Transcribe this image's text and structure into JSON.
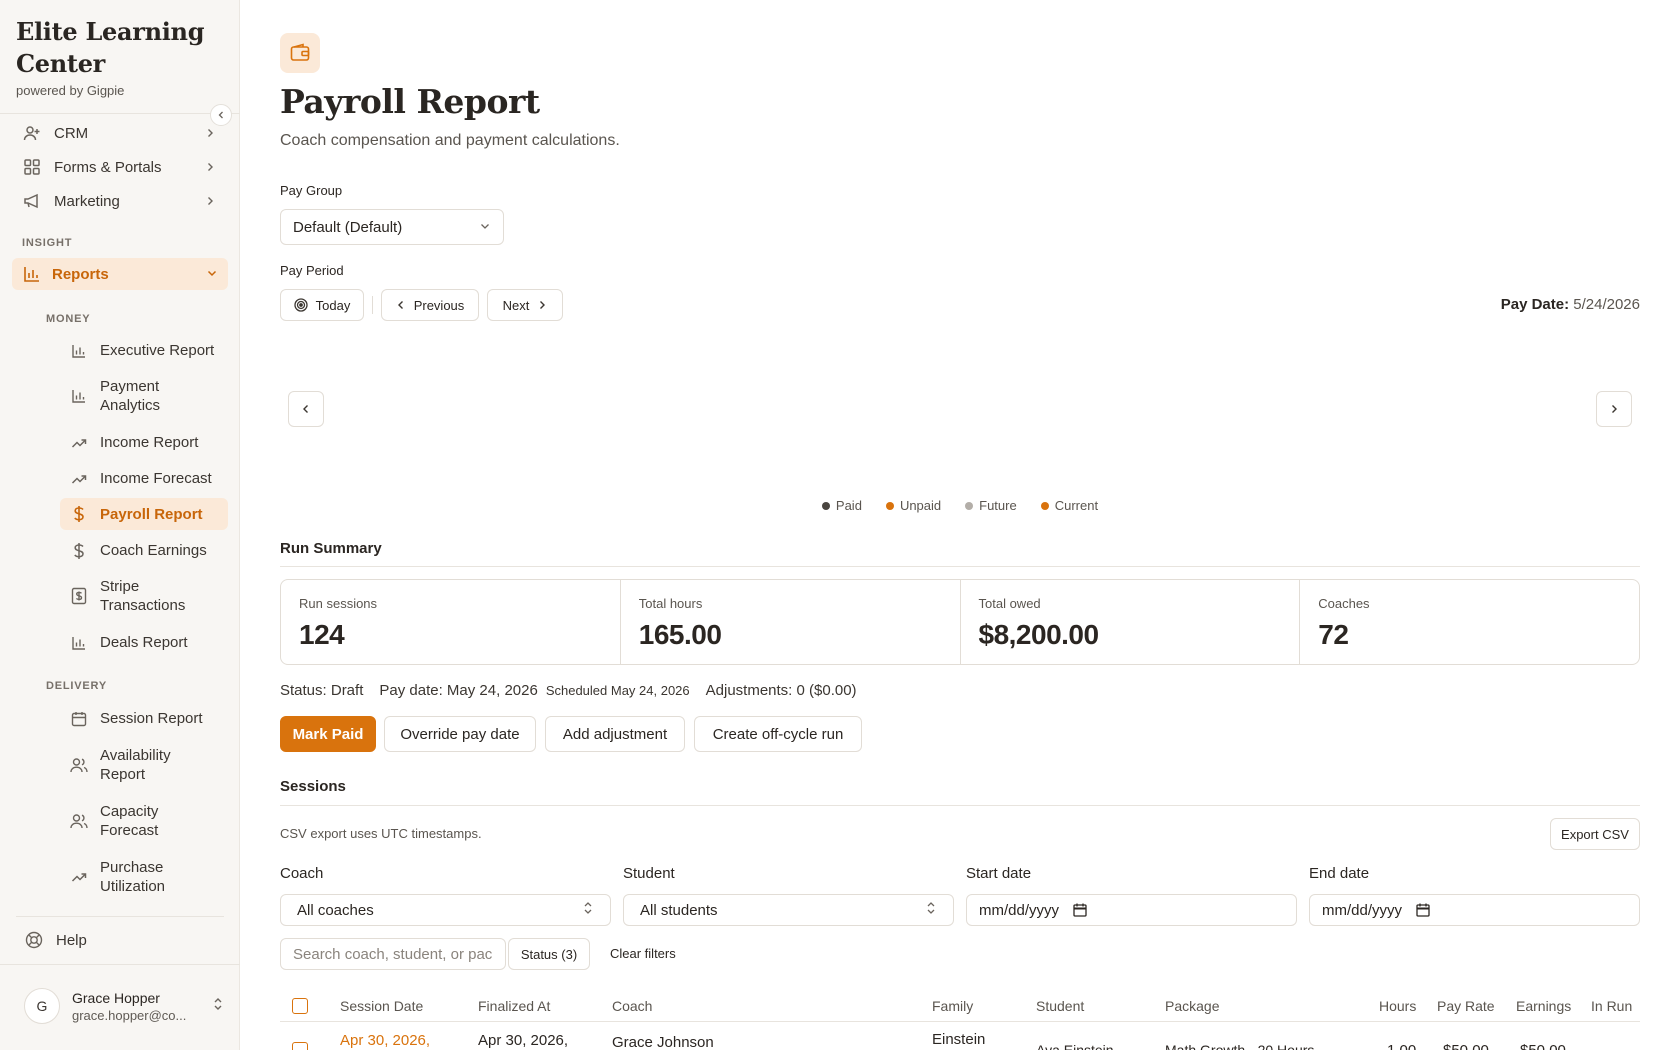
{
  "brand": {
    "title": "Elite Learning Center",
    "subtitle": "powered by Gigpie"
  },
  "nav": {
    "top": [
      {
        "label": "CRM",
        "icon": "user-plus-icon"
      },
      {
        "label": "Forms & Portals",
        "icon": "grid-icon"
      },
      {
        "label": "Marketing",
        "icon": "megaphone-icon"
      }
    ],
    "insight_label": "INSIGHT",
    "reports_label": "Reports",
    "money_label": "MONEY",
    "money_items": [
      {
        "label": "Executive Report",
        "icon": "bar-chart-icon"
      },
      {
        "label": "Payment Analytics",
        "icon": "bar-chart-icon"
      },
      {
        "label": "Income Report",
        "icon": "trending-up-icon"
      },
      {
        "label": "Income Forecast",
        "icon": "trending-up-icon"
      },
      {
        "label": "Payroll Report",
        "icon": "dollar-icon"
      },
      {
        "label": "Coach Earnings",
        "icon": "dollar-icon"
      },
      {
        "label": "Stripe Transactions",
        "icon": "receipt-icon"
      },
      {
        "label": "Deals Report",
        "icon": "bar-chart-icon"
      }
    ],
    "delivery_label": "DELIVERY",
    "delivery_items": [
      {
        "label": "Session Report",
        "icon": "calendar-icon"
      },
      {
        "label": "Availability Report",
        "icon": "users-icon"
      },
      {
        "label": "Capacity Forecast",
        "icon": "users-icon"
      },
      {
        "label": "Purchase Utilization",
        "icon": "trending-up-icon"
      }
    ],
    "help_label": "Help"
  },
  "user": {
    "initial": "G",
    "name": "Grace Hopper",
    "email": "grace.hopper@co..."
  },
  "page": {
    "title": "Payroll Report",
    "subtitle": "Coach compensation and payment calculations."
  },
  "pay_group": {
    "label": "Pay Group",
    "value": "Default (Default)"
  },
  "pay_period": {
    "label": "Pay Period",
    "today": "Today",
    "previous": "Previous",
    "next": "Next",
    "pay_date_label": "Pay Date:",
    "pay_date_value": "5/24/2026"
  },
  "legend": [
    {
      "label": "Paid",
      "color": "#4a4540"
    },
    {
      "label": "Unpaid",
      "color": "#d9730d"
    },
    {
      "label": "Future",
      "color": "#b3aea8"
    },
    {
      "label": "Current",
      "color": "#d9730d"
    }
  ],
  "run_summary": {
    "title": "Run Summary",
    "stats": [
      {
        "label": "Run sessions",
        "value": "124"
      },
      {
        "label": "Total hours",
        "value": "165.00"
      },
      {
        "label": "Total owed",
        "value": "$8,200.00"
      },
      {
        "label": "Coaches",
        "value": "72"
      }
    ],
    "status": "Status: Draft",
    "pay_date": "Pay date: May 24, 2026",
    "scheduled": "Scheduled May 24, 2026",
    "adjustments": "Adjustments: 0 ($0.00)"
  },
  "actions": {
    "mark_paid": "Mark Paid",
    "override": "Override pay date",
    "add_adjustment": "Add adjustment",
    "off_cycle": "Create off-cycle run"
  },
  "sessions": {
    "title": "Sessions",
    "note": "CSV export uses UTC timestamps.",
    "export": "Export CSV",
    "filters": {
      "coach_label": "Coach",
      "coach_value": "All coaches",
      "student_label": "Student",
      "student_value": "All students",
      "start_label": "Start date",
      "start_value": "mm/dd/yyyy",
      "end_label": "End date",
      "end_value": "mm/dd/yyyy",
      "search_placeholder": "Search coach, student, or pac",
      "status": "Status (3)",
      "clear": "Clear filters"
    },
    "columns": [
      "Session Date",
      "Finalized At",
      "Coach",
      "Family",
      "Student",
      "Package",
      "Hours",
      "Pay Rate",
      "Earnings",
      "In Run"
    ],
    "rows": [
      {
        "date": "Apr 30, 2026,",
        "finalized": "Apr 30, 2026,",
        "coach": "Grace Johnson",
        "family": "Einstein",
        "student": "Ava Einstein",
        "package": "Math Growth - 20 Hours",
        "hours": "1.00",
        "rate": "$50.00",
        "earnings": "$50.00"
      }
    ]
  },
  "colors": {
    "accent": "#d9730d",
    "accent_soft": "#fbe9d8"
  }
}
